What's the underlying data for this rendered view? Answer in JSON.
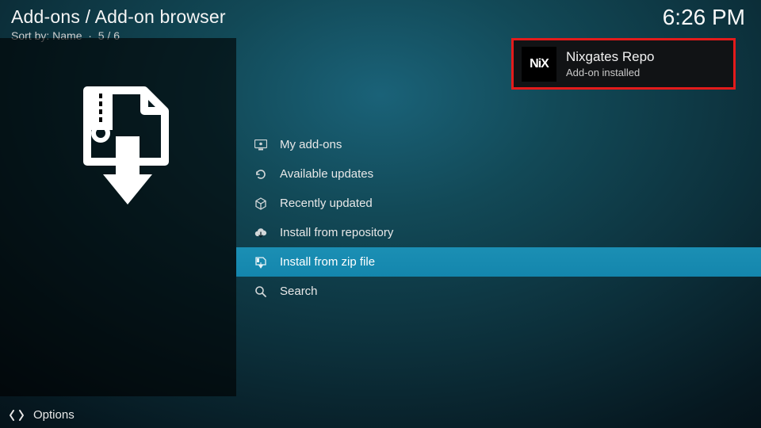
{
  "header": {
    "breadcrumb": "Add-ons / Add-on browser",
    "sort_label": "Sort by:",
    "sort_value": "Name",
    "separator": "·",
    "position": "5 / 6"
  },
  "clock": "6:26 PM",
  "menu": {
    "items": [
      {
        "label": "My add-ons",
        "icon": "screen-icon",
        "selected": false
      },
      {
        "label": "Available updates",
        "icon": "refresh-icon",
        "selected": false
      },
      {
        "label": "Recently updated",
        "icon": "box-icon",
        "selected": false
      },
      {
        "label": "Install from repository",
        "icon": "cloud-icon",
        "selected": false
      },
      {
        "label": "Install from zip file",
        "icon": "zip-icon",
        "selected": true
      },
      {
        "label": "Search",
        "icon": "search-icon",
        "selected": false
      }
    ]
  },
  "toast": {
    "logo_text": "NiX",
    "title": "Nixgates Repo",
    "subtitle": "Add-on installed"
  },
  "footer": {
    "options_label": "Options"
  },
  "colors": {
    "highlight_border": "#e31b1b",
    "selected_bg": "#1486ad"
  }
}
